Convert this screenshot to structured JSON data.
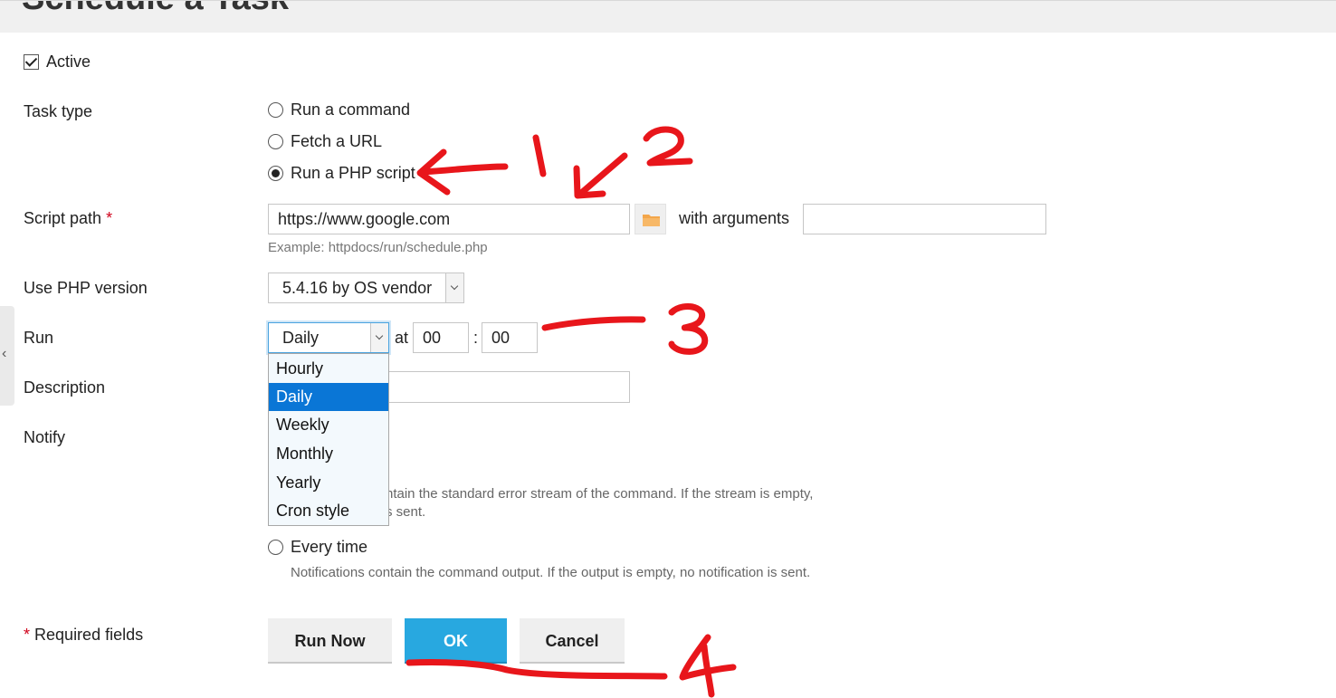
{
  "header": {
    "title": "Schedule a Task"
  },
  "active": {
    "label": "Active",
    "checked": true
  },
  "task_type": {
    "label": "Task type",
    "options": [
      {
        "label": "Run a command",
        "selected": false
      },
      {
        "label": "Fetch a URL",
        "selected": false
      },
      {
        "label": "Run a PHP script",
        "selected": true
      }
    ]
  },
  "script_path": {
    "label": "Script path",
    "required_mark": "*",
    "value": "https://www.google.com",
    "example": "Example: httpdocs/run/schedule.php",
    "arguments_label": "with arguments",
    "arguments_value": ""
  },
  "php_version": {
    "label": "Use PHP version",
    "value": "5.4.16 by OS vendor"
  },
  "run": {
    "label": "Run",
    "value": "Daily",
    "at_label": "at",
    "hour": "00",
    "separator": ":",
    "minute": "00",
    "options": [
      "Hourly",
      "Daily",
      "Weekly",
      "Monthly",
      "Yearly",
      "Cron style"
    ],
    "selected_index": 1
  },
  "description": {
    "label": "Description",
    "value": ""
  },
  "notify": {
    "label": "Notify",
    "errors_hint_line1": "ntain the standard error stream of the command. If the stream is empty,",
    "errors_hint_line2": "s sent.",
    "every_time_label": "Every time",
    "every_time_hint": "Notifications contain the command output. If the output is empty, no notification is sent."
  },
  "footer": {
    "required_mark": "*",
    "required_label": "Required fields",
    "run_now": "Run Now",
    "ok": "OK",
    "cancel": "Cancel"
  },
  "annotations": {
    "n1": "1",
    "n2": "2",
    "n3": "3",
    "n4": "4",
    "color": "#e8161b"
  },
  "icons": {
    "folder": "folder-icon",
    "collapse": "chevron-left-icon"
  }
}
